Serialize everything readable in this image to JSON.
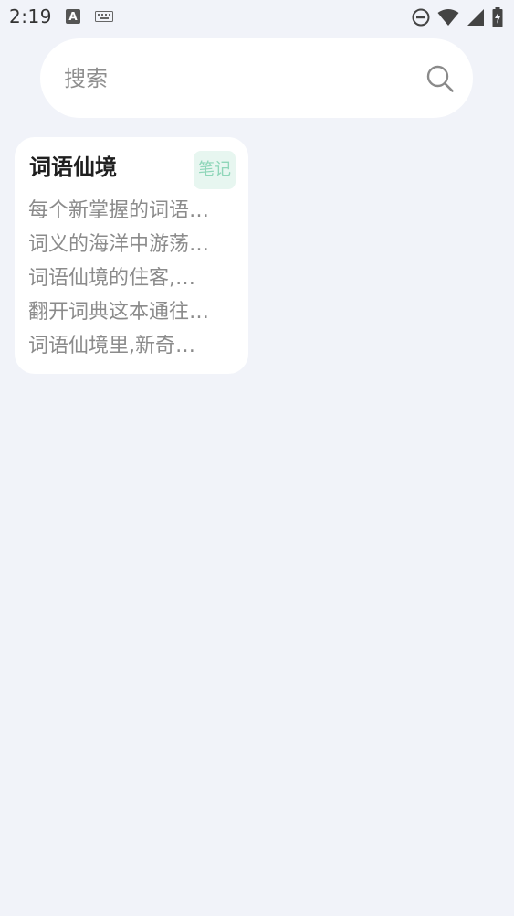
{
  "status_bar": {
    "time": "2:19",
    "a_icon_letter": "A",
    "left_icons": [
      "a-icon",
      "keyboard-icon"
    ],
    "right_icons": [
      "do-not-disturb-icon",
      "wifi-icon",
      "cellular-signal-icon",
      "battery-charging-icon"
    ]
  },
  "search": {
    "placeholder": "搜索",
    "icon": "search-icon"
  },
  "notes": [
    {
      "title": "词语仙境",
      "tag": "笔记",
      "lines": [
        "每个新掌握的词语…",
        "词义的海洋中游荡…",
        "词语仙境的住客,…",
        "翻开词典这本通往…",
        "词语仙境里,新奇…"
      ]
    }
  ],
  "colors": {
    "background": "#f1f3f9",
    "card": "#ffffff",
    "tag_bg": "#e7f6f0",
    "tag_text": "#8fd6b9",
    "preview_text": "#8b8b8b"
  }
}
